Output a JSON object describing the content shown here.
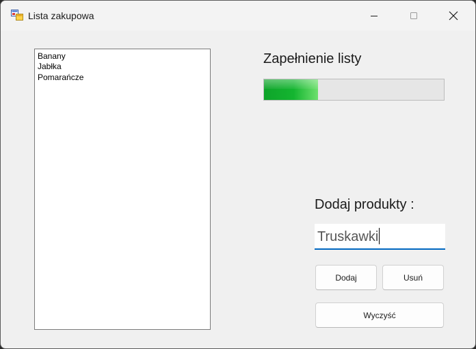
{
  "window": {
    "title": "Lista zakupowa",
    "controls": {
      "minimize_icon": "minimize-icon",
      "maximize_icon": "maximize-icon",
      "close_icon": "close-icon"
    }
  },
  "list": {
    "items": [
      "Banany",
      "Jabłka",
      "Pomarańcze"
    ]
  },
  "progress": {
    "label": "Zapełnienie listy",
    "fraction": 0.3,
    "color": "#14b530"
  },
  "add_section": {
    "label": "Dodaj produkty :",
    "input_value": "Truskawki",
    "add_button": "Dodaj",
    "remove_button": "Usuń",
    "clear_button": "Wyczyść"
  },
  "colors": {
    "window_bg": "#f0f0f0",
    "accent": "#0067c0"
  }
}
